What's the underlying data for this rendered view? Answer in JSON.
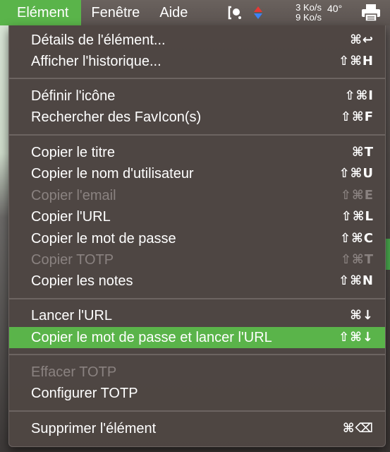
{
  "menubar": {
    "menus": [
      {
        "label": "Elément",
        "active": true
      },
      {
        "label": "Fenêtre",
        "active": false
      },
      {
        "label": "Aide",
        "active": false
      }
    ],
    "status": {
      "upload": "3 Ko/s",
      "download": "9 Ko/s",
      "temperature": "40°",
      "app_icon": "bracket-dot-icon",
      "printer_icon": "printer-icon"
    }
  },
  "dropdown": {
    "items": [
      {
        "label": "Détails de l'élément...",
        "shortcut": "⌘↩",
        "enabled": true,
        "highlighted": false
      },
      {
        "label": "Afficher l'historique...",
        "shortcut": "⇧⌘H",
        "enabled": true,
        "highlighted": false
      },
      {
        "label": "Définir l'icône",
        "shortcut": "⇧⌘I",
        "enabled": true,
        "highlighted": false
      },
      {
        "label": "Rechercher des FavIcon(s)",
        "shortcut": "⇧⌘F",
        "enabled": true,
        "highlighted": false
      },
      {
        "label": "Copier le titre",
        "shortcut": "⌘T",
        "enabled": true,
        "highlighted": false
      },
      {
        "label": "Copier le nom d'utilisateur",
        "shortcut": "⇧⌘U",
        "enabled": true,
        "highlighted": false
      },
      {
        "label": "Copier l'email",
        "shortcut": "⇧⌘E",
        "enabled": false,
        "highlighted": false
      },
      {
        "label": "Copier l'URL",
        "shortcut": "⇧⌘L",
        "enabled": true,
        "highlighted": false
      },
      {
        "label": "Copier le mot de passe",
        "shortcut": "⇧⌘C",
        "enabled": true,
        "highlighted": false
      },
      {
        "label": "Copier TOTP",
        "shortcut": "⇧⌘T",
        "enabled": false,
        "highlighted": false
      },
      {
        "label": "Copier les notes",
        "shortcut": "⇧⌘N",
        "enabled": true,
        "highlighted": false
      },
      {
        "label": "Lancer l'URL",
        "shortcut": "⌘↓",
        "enabled": true,
        "highlighted": false
      },
      {
        "label": "Copier le mot de passe et lancer l'URL",
        "shortcut": "⇧⌘↓",
        "enabled": true,
        "highlighted": true
      },
      {
        "label": "Effacer TOTP",
        "shortcut": "",
        "enabled": false,
        "highlighted": false
      },
      {
        "label": "Configurer TOTP",
        "shortcut": "",
        "enabled": true,
        "highlighted": false
      },
      {
        "label": "Supprimer l'élément",
        "shortcut": "⌘⌫",
        "enabled": true,
        "highlighted": false
      }
    ]
  },
  "colors": {
    "highlight": "#5ab44a",
    "disabled_text": "#8a8280",
    "menu_background": "#4e4643"
  }
}
